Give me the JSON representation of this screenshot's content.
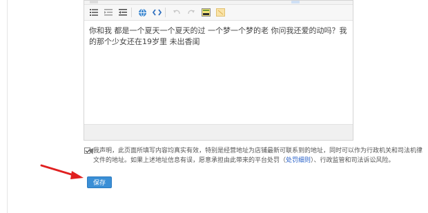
{
  "editor": {
    "toolbar_icons": [
      "list-icon",
      "indent-icon",
      "outdent-icon",
      "link-globe-icon",
      "source-code-icon",
      "undo-icon",
      "redo-icon",
      "image-icon",
      "table-icon"
    ],
    "content": "你和我 都是一个夏天一个夏天的过 一个梦一个梦的老 你问我还爱的动吗？我的那个少女还在19岁里 未出香闺"
  },
  "consent": {
    "text_part1": "我声明，此页面所填写内容均真实有效，特别是经营地址为店铺最新可联系到的地址，同时可以作为行政机关和司法机律文件的地址。如果上述地址信息有误，愿意承担由此带来的平台处罚（",
    "link_label": "处罚细则",
    "text_part2": "）、行政监管和司法诉讼风险。"
  },
  "actions": {
    "save_label": "保存"
  },
  "colors": {
    "accent": "#3a8fd6",
    "arrow": "#e02020",
    "link": "#2a62c9"
  }
}
